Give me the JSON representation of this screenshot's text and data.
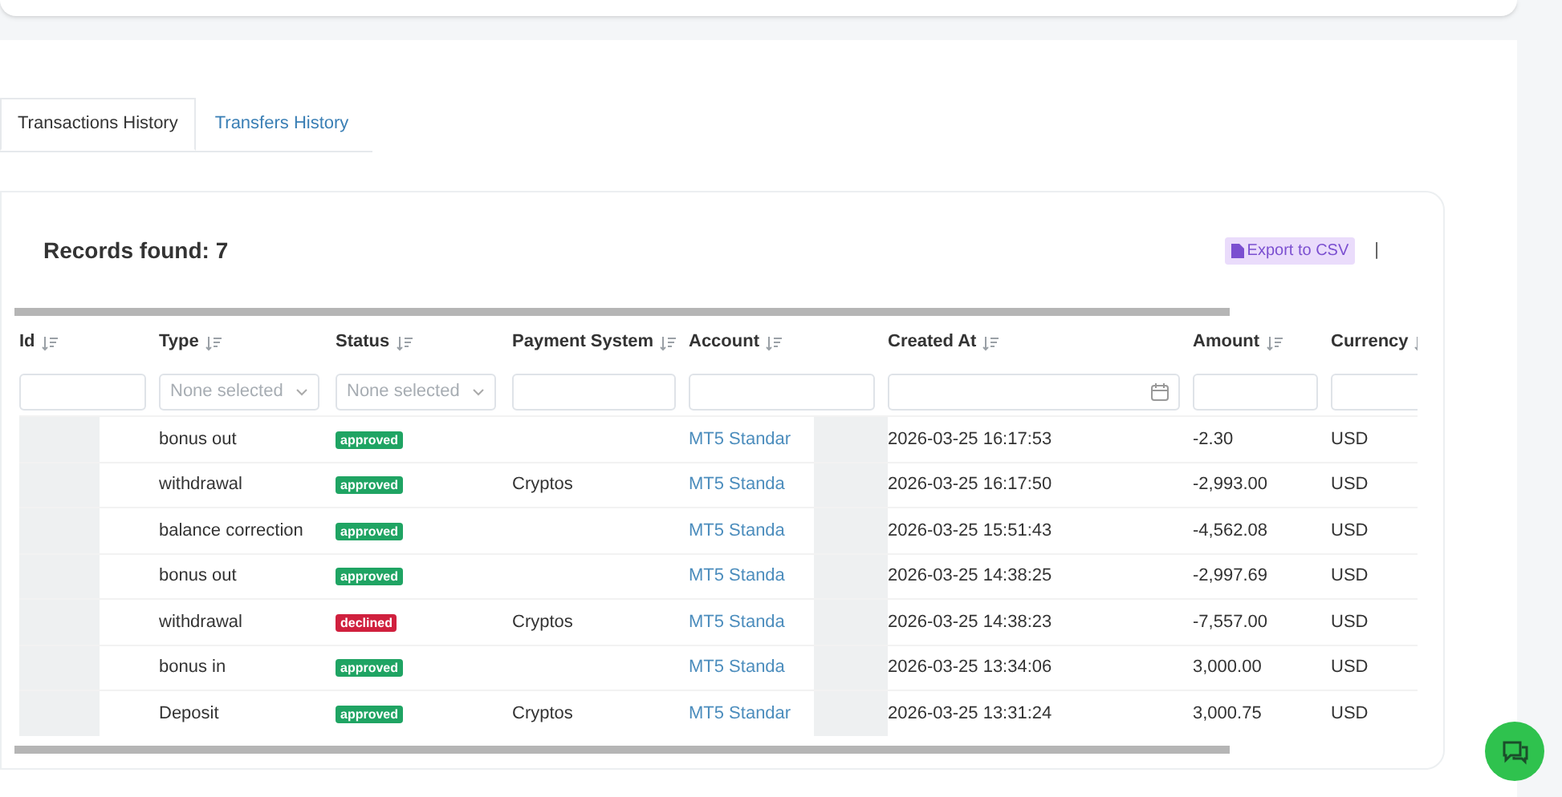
{
  "tabs": [
    {
      "label": "Transactions History",
      "selected": true
    },
    {
      "label": "Transfers History",
      "selected": false
    }
  ],
  "records_title": "Records found: 7",
  "export_button": "Export to CSV",
  "toolbar_divider": "|",
  "table": {
    "columns": [
      {
        "label": "Id",
        "kind": "text"
      },
      {
        "label": "Type",
        "kind": "select",
        "placeholder": "None selected"
      },
      {
        "label": "Status",
        "kind": "select",
        "placeholder": "None selected"
      },
      {
        "label": "Payment System",
        "kind": "text"
      },
      {
        "label": "Account",
        "kind": "text"
      },
      {
        "label": "Created At",
        "kind": "date"
      },
      {
        "label": "Amount",
        "kind": "text"
      },
      {
        "label": "Currency",
        "kind": "text"
      }
    ],
    "rows": [
      {
        "type": "bonus out",
        "status": {
          "label": "approved",
          "color": "#1fa463"
        },
        "payment_system": "",
        "account": "MT5 Standar",
        "created_at": "2026-03-25 16:17:53",
        "amount": "-2.30",
        "currency": "USD"
      },
      {
        "type": "withdrawal",
        "status": {
          "label": "approved",
          "color": "#1fa463"
        },
        "payment_system": "Cryptos",
        "account": "MT5 Standa",
        "created_at": "2026-03-25 16:17:50",
        "amount": "-2,993.00",
        "currency": "USD"
      },
      {
        "type": "balance correction",
        "status": {
          "label": "approved",
          "color": "#1fa463"
        },
        "payment_system": "",
        "account": "MT5 Standa",
        "created_at": "2026-03-25 15:51:43",
        "amount": "-4,562.08",
        "currency": "USD"
      },
      {
        "type": "bonus out",
        "status": {
          "label": "approved",
          "color": "#1fa463"
        },
        "payment_system": "",
        "account": "MT5 Standa",
        "created_at": "2026-03-25 14:38:25",
        "amount": "-2,997.69",
        "currency": "USD"
      },
      {
        "type": "withdrawal",
        "status": {
          "label": "declined",
          "color": "#d0203e"
        },
        "payment_system": "Cryptos",
        "account": "MT5 Standa",
        "created_at": "2026-03-25 14:38:23",
        "amount": "-7,557.00",
        "currency": "USD"
      },
      {
        "type": "bonus in",
        "status": {
          "label": "approved",
          "color": "#1fa463"
        },
        "payment_system": "",
        "account": "MT5 Standa",
        "created_at": "2026-03-25 13:34:06",
        "amount": "3,000.00",
        "currency": "USD"
      },
      {
        "type": "Deposit",
        "status": {
          "label": "approved",
          "color": "#1fa463"
        },
        "payment_system": "Cryptos",
        "account": "MT5 Standar",
        "created_at": "2026-03-25 13:31:24",
        "amount": "3,000.75",
        "currency": "USD"
      }
    ]
  }
}
